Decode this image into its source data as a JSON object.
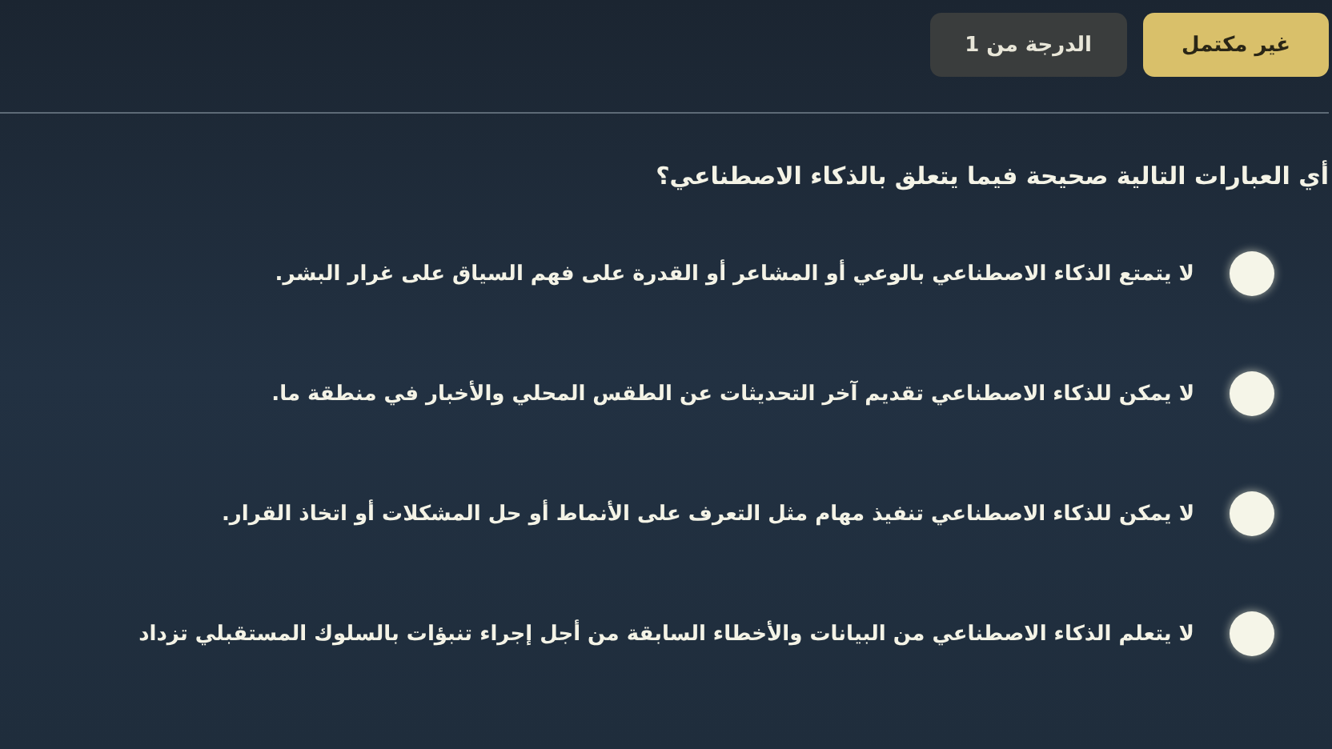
{
  "status_badges": [
    {
      "label": "غير مكتمل",
      "kind": "status"
    },
    {
      "label": "الدرجة من 1",
      "kind": "score"
    }
  ],
  "question": "أي العبارات التالية صحيحة فيما يتعلق بالذكاء الاصطناعي؟",
  "options": [
    {
      "label": "لا يتمتع الذكاء الاصطناعي بالوعي أو المشاعر أو القدرة على فهم السياق على غرار البشر.",
      "selected": false
    },
    {
      "label": "لا يمكن للذكاء الاصطناعي تقديم آخر التحديثات عن الطقس المحلي والأخبار في منطقة ما.",
      "selected": false
    },
    {
      "label": "لا يمكن للذكاء الاصطناعي تنفيذ مهام مثل التعرف على الأنماط أو حل المشكلات أو اتخاذ القرار.",
      "selected": false
    },
    {
      "label": "لا يتعلم الذكاء الاصطناعي من البيانات والأخطاء السابقة من أجل إجراء تنبؤات بالسلوك المستقبلي تزداد",
      "selected": false
    }
  ]
}
